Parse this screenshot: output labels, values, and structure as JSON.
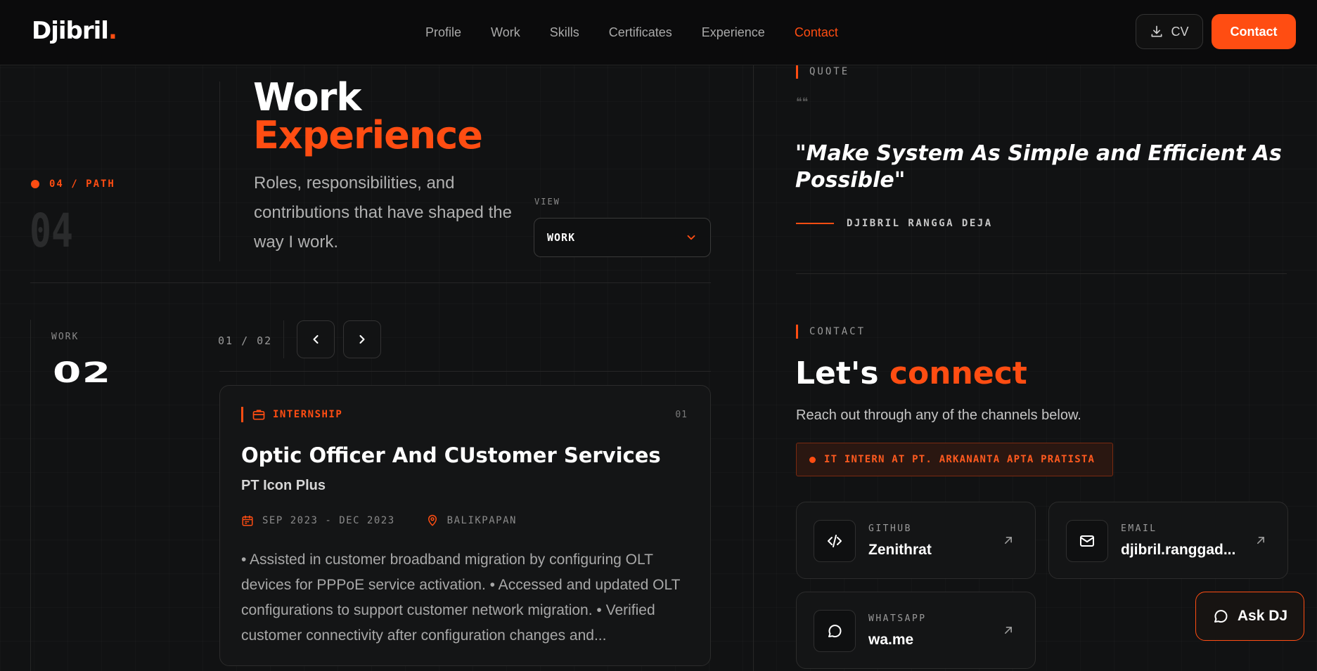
{
  "header": {
    "logo": "Djibril",
    "logo_dot": ".",
    "nav": [
      {
        "label": "Profile"
      },
      {
        "label": "Work"
      },
      {
        "label": "Skills"
      },
      {
        "label": "Certificates"
      },
      {
        "label": "Experience"
      },
      {
        "label": "Contact"
      }
    ],
    "cv_label": "CV",
    "contact_label": "Contact"
  },
  "hero": {
    "path_tag": "04 / PATH",
    "big_number": "04",
    "title_line1": "Work",
    "title_line2": "Experience",
    "subtitle": "Roles, responsibilities, and contributions that have shaped the way I work.",
    "view_label": "VIEW",
    "view_value": "WORK"
  },
  "work": {
    "label": "WORK",
    "count": "02",
    "pager": "01 / 02",
    "card": {
      "tag": "INTERNSHIP",
      "index": "01",
      "title": "Optic Officer And CUstomer Services",
      "company": "PT Icon Plus",
      "dates": "SEP 2023 - DEC 2023",
      "location": "BALIKPAPAN",
      "description": "• Assisted in customer broadband migration by configuring OLT devices for PPPoE service activation. • Accessed and updated OLT configurations to support customer network migration. • Verified customer connectivity after configuration changes and..."
    }
  },
  "quote": {
    "tag": "QUOTE",
    "mark": "❝❝",
    "text": "\"Make System As Simple and Efficient As Possible\"",
    "author": "DJIBRIL RANGGA DEJA"
  },
  "contact": {
    "tag": "CONTACT",
    "title_white": "Let's",
    "title_orange": "connect",
    "subtitle": "Reach out through any of the channels below.",
    "status": "IT INTERN AT PT. ARKANANTA APTA PRATISTA",
    "tiles": [
      {
        "label": "GITHUB",
        "value": "Zenithrat",
        "icon": "code-icon"
      },
      {
        "label": "EMAIL",
        "value": "djibril.ranggad...",
        "icon": "mail-icon"
      },
      {
        "label": "WHATSAPP",
        "value": "wa.me",
        "icon": "chat-icon"
      }
    ]
  },
  "assistant": {
    "label": "Ask DJ"
  },
  "colors": {
    "accent": "#ff4d12",
    "background": "#111213",
    "header": "#0b0b0c"
  }
}
